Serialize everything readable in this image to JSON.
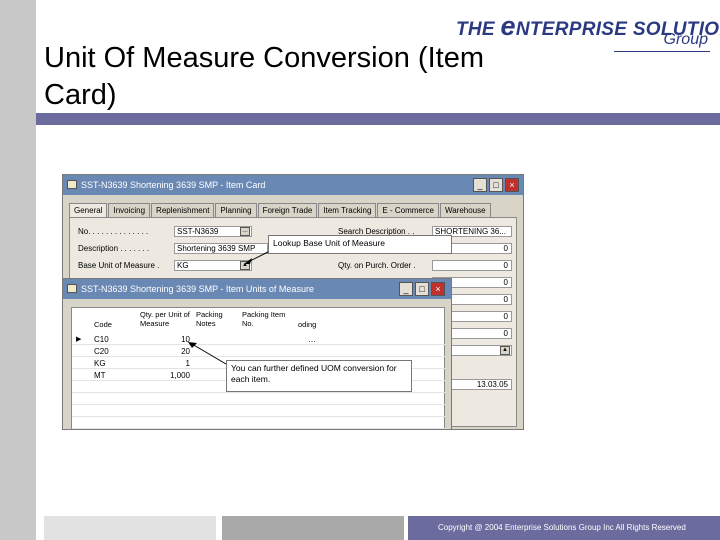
{
  "slide": {
    "title": "Unit Of Measure Conversion (Item Card)",
    "copyright": "Copyright @ 2004 Enterprise Solutions Group Inc All Rights Reserved"
  },
  "logo": {
    "line1_prefix": "THE ",
    "line1_e": "e",
    "line1_rest": "NTERPRISE SOLUTIONS",
    "line2": "Group"
  },
  "item_card": {
    "title": "SST-N3639 Shortening 3639 SMP - Item Card",
    "tabs": [
      "General",
      "Invoicing",
      "Replenishment",
      "Planning",
      "Foreign Trade",
      "Item Tracking",
      "E - Commerce",
      "Warehouse"
    ],
    "fields": {
      "no_label": "No. . . . . . . . . . . . . .",
      "no_value": "SST-N3639",
      "description_label": "Description . . . . . . .",
      "description_value": "Shortening 3639 SMP",
      "base_uom_label": "Base Unit of Measure .",
      "base_uom_value": "KG",
      "search_desc_label": "Search Description . .",
      "search_desc_value": "SHORTENING 36...",
      "qty_purch_label": "Qty. on Purch. Order .",
      "right_values": [
        "0",
        "0",
        "0",
        "0",
        "0",
        "0"
      ],
      "date_value": "13.03.05"
    }
  },
  "uom_window": {
    "title": "SST-N3639 Shortening 3639 SMP - Item Units of Measure",
    "headers": {
      "code": "Code",
      "qty_per": "Qty. per Unit of Measure",
      "packing_notes": "Packing Notes",
      "packing_item": "Packing Item No.",
      "coding": "oding"
    },
    "rows": [
      {
        "code": "C10",
        "qty": "10",
        "selected": true
      },
      {
        "code": "C20",
        "qty": "20",
        "selected": false
      },
      {
        "code": "KG",
        "qty": "1",
        "selected": false
      },
      {
        "code": "MT",
        "qty": "1,000",
        "selected": false
      }
    ]
  },
  "callouts": {
    "lookup": "Lookup Base Unit of Measure",
    "uom": "You can further defined UOM conversion for each item."
  },
  "window_buttons": {
    "minimize": "_",
    "maximize": "□",
    "close": "×"
  }
}
